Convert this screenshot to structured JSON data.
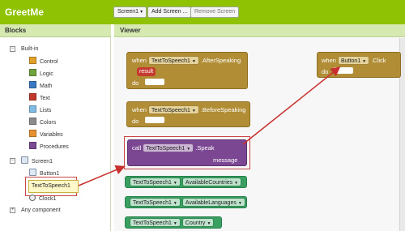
{
  "app": {
    "title": "GreetMe",
    "screen_select": "Screen1",
    "add_screen": "Add Screen ...",
    "remove_screen": "Remove Screen"
  },
  "blocks_panel": {
    "header": "Blocks",
    "builtin": {
      "label": "Built-in",
      "items": [
        {
          "label": "Control",
          "color": "#e1a22b"
        },
        {
          "label": "Logic",
          "color": "#6fa33f"
        },
        {
          "label": "Math",
          "color": "#3a78c4"
        },
        {
          "label": "Text",
          "color": "#c0392b"
        },
        {
          "label": "Lists",
          "color": "#7fbbe3"
        },
        {
          "label": "Colors",
          "color": "#8c8c8c"
        },
        {
          "label": "Variables",
          "color": "#e6912e"
        },
        {
          "label": "Procedures",
          "color": "#7a4a93"
        }
      ]
    },
    "screen": {
      "label": "Screen1",
      "items": [
        "Button1",
        "TextToSpeech1",
        "Clock1"
      ]
    },
    "any_component": "Any component"
  },
  "viewer": {
    "header": "Viewer",
    "after_speaking": {
      "when": "when",
      "component": "TextToSpeech1",
      "event": ".AfterSpeaking",
      "param": "result",
      "do": "do"
    },
    "before_speaking": {
      "when": "when",
      "component": "TextToSpeech1",
      "event": ".BeforeSpeaking",
      "do": "do"
    },
    "speak": {
      "call": "call",
      "component": "TextToSpeech1",
      "method": ".Speak",
      "arg": "message"
    },
    "properties": [
      {
        "component": "TextToSpeech1",
        "property": "AvailableCountries"
      },
      {
        "component": "TextToSpeech1",
        "property": "AvailableLanguages"
      },
      {
        "component": "TextToSpeech1",
        "property": "Country"
      }
    ],
    "button_click": {
      "when": "when",
      "component": "Button1",
      "event": ".Click",
      "do": "do"
    }
  }
}
